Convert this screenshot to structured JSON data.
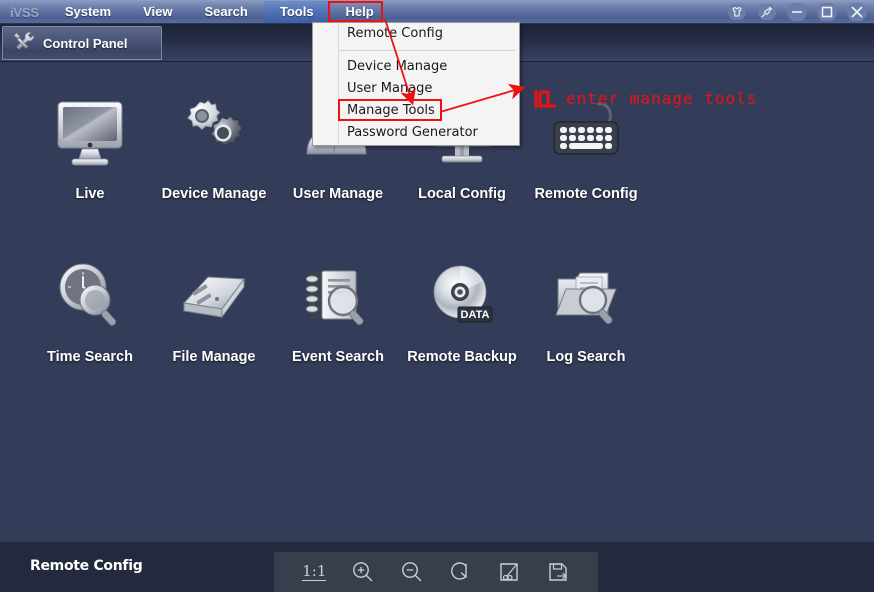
{
  "window": {
    "brand": "iVSS",
    "menus": [
      {
        "label": "System",
        "active": false
      },
      {
        "label": "View",
        "active": false
      },
      {
        "label": "Search",
        "active": false
      },
      {
        "label": "Tools",
        "active": true
      },
      {
        "label": "Help",
        "active": false
      }
    ],
    "controls": [
      {
        "name": "skin-icon",
        "label": "Skin"
      },
      {
        "name": "pin-icon",
        "label": "Pin"
      },
      {
        "name": "minimize-icon",
        "label": "Minimize"
      },
      {
        "name": "maximize-icon",
        "label": "Maximize"
      },
      {
        "name": "close-icon",
        "label": "Close"
      }
    ]
  },
  "tabs": [
    {
      "label": "Control Panel",
      "icon": "tools-icon",
      "active": true
    }
  ],
  "dropdown": {
    "owner": "Tools",
    "items": [
      {
        "label": "Remote Config",
        "highlighted": false
      },
      {
        "separator": true
      },
      {
        "label": "Device Manage",
        "highlighted": false
      },
      {
        "label": "User Manage",
        "highlighted": false
      },
      {
        "label": "Manage Tools",
        "highlighted": true
      },
      {
        "label": "Password Generator",
        "highlighted": false
      }
    ]
  },
  "shortcuts": {
    "row1": [
      {
        "label": "Live",
        "icon": "monitor-icon"
      },
      {
        "label": "Device Manage",
        "icon": "gears-icon"
      },
      {
        "label": "User Manage",
        "icon": "users-icon"
      },
      {
        "label": "Local Config",
        "icon": "local-config-icon"
      },
      {
        "label": "Remote Config",
        "icon": "keyboard-icon"
      }
    ],
    "row2": [
      {
        "label": "Time Search",
        "icon": "clock-search-icon"
      },
      {
        "label": "File Manage",
        "icon": "binder-icon"
      },
      {
        "label": "Event Search",
        "icon": "notebook-search-icon"
      },
      {
        "label": "Remote Backup",
        "icon": "disc-data-icon"
      },
      {
        "label": "Log Search",
        "icon": "folder-search-icon"
      }
    ]
  },
  "statusbar": {
    "title": "Remote Config",
    "tools": [
      {
        "name": "actual-size-button",
        "label": "1:1"
      },
      {
        "name": "zoom-in-button",
        "label": "Zoom In"
      },
      {
        "name": "zoom-out-button",
        "label": "Zoom Out"
      },
      {
        "name": "rotate-button",
        "label": "Rotate"
      },
      {
        "name": "crop-button",
        "label": "Crop"
      },
      {
        "name": "save-button",
        "label": "Save"
      }
    ]
  },
  "annotations": {
    "text": "enter manage tools",
    "color": "#ee1111",
    "boxes": [
      "Tools",
      "Manage Tools"
    ]
  },
  "colors": {
    "background": "#333c58",
    "menubar": "#5b6e9e",
    "tabbar": "#252c44",
    "statusbar": "#232a3d",
    "toolbar": "#393e4c",
    "annotation": "#ee1111"
  }
}
